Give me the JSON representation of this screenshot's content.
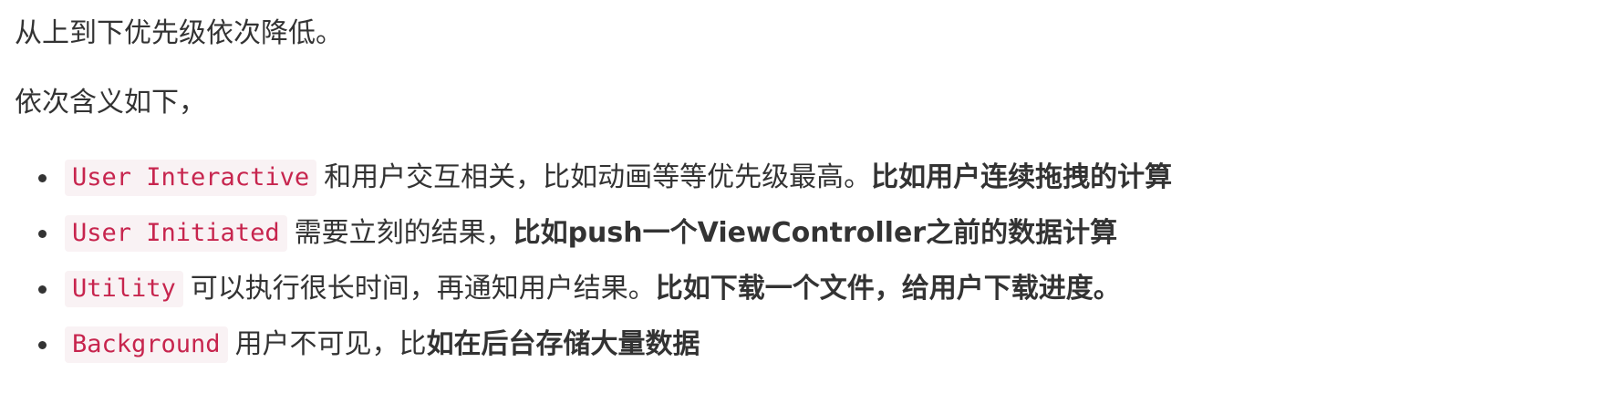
{
  "intro": {
    "line1": "从上到下优先级依次降低。",
    "line2": "依次含义如下，"
  },
  "items": [
    {
      "code": "User Interactive",
      "text": "和用户交互相关，比如动画等等优先级最高。",
      "bold": "比如用户连续拖拽的计算"
    },
    {
      "code": "User Initiated",
      "text": "需要立刻的结果，",
      "bold": "比如push一个ViewController之前的数据计算"
    },
    {
      "code": "Utility",
      "text": "可以执行很长时间，再通知用户结果。",
      "bold": "比如下载一个文件，给用户下载进度。"
    },
    {
      "code": "Background",
      "text": "用户不可见，比",
      "bold": "如在后台存储大量数据"
    }
  ],
  "colors": {
    "text": "#333333",
    "code_text": "#c7254e",
    "code_bg": "#f9f2f4"
  }
}
